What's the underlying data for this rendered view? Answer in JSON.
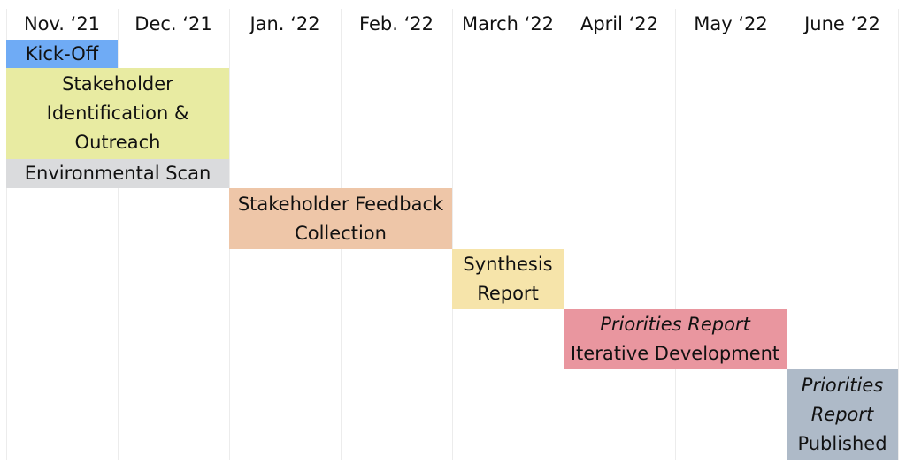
{
  "chart_data": {
    "type": "gantt",
    "months": [
      "Nov. ‘21",
      "Dec. ‘21",
      "Jan. ‘22",
      "Feb. ‘22",
      "March ‘22",
      "April ‘22",
      "May ‘22",
      "June ‘22"
    ],
    "tasks": [
      {
        "lines": [
          {
            "text": "Kick-Off",
            "italic": false
          }
        ],
        "start_month": "Nov. ‘21",
        "end_month": "Nov. ‘21",
        "color": "#6fabf5"
      },
      {
        "lines": [
          {
            "text": "Stakeholder",
            "italic": false
          },
          {
            "text": "Identification &",
            "italic": false
          },
          {
            "text": "Outreach",
            "italic": false
          }
        ],
        "start_month": "Nov. ‘21",
        "end_month": "Dec. ‘21",
        "color": "#e8eba2"
      },
      {
        "lines": [
          {
            "text": "Environmental Scan",
            "italic": false
          }
        ],
        "start_month": "Nov. ‘21",
        "end_month": "Dec. ‘21",
        "color": "#dadbdd"
      },
      {
        "lines": [
          {
            "text": "Stakeholder Feedback",
            "italic": false
          },
          {
            "text": "Collection",
            "italic": false
          }
        ],
        "start_month": "Jan. ‘22",
        "end_month": "Feb. ‘22",
        "color": "#eec6a8"
      },
      {
        "lines": [
          {
            "text": "Synthesis",
            "italic": false
          },
          {
            "text": "Report",
            "italic": false
          }
        ],
        "start_month": "March ‘22",
        "end_month": "March ‘22",
        "color": "#f6e4aa"
      },
      {
        "lines": [
          {
            "text": "Priorities Report",
            "italic": true
          },
          {
            "text": "Iterative Development",
            "italic": false
          }
        ],
        "start_month": "April ‘22",
        "end_month": "May ‘22",
        "color": "#e9969f"
      },
      {
        "lines": [
          {
            "text": "Priorities",
            "italic": true
          },
          {
            "text": "Report",
            "italic": true
          },
          {
            "text": "Published",
            "italic": false
          }
        ],
        "start_month": "June ‘22",
        "end_month": "June ‘22",
        "color": "#aebac8"
      }
    ]
  }
}
